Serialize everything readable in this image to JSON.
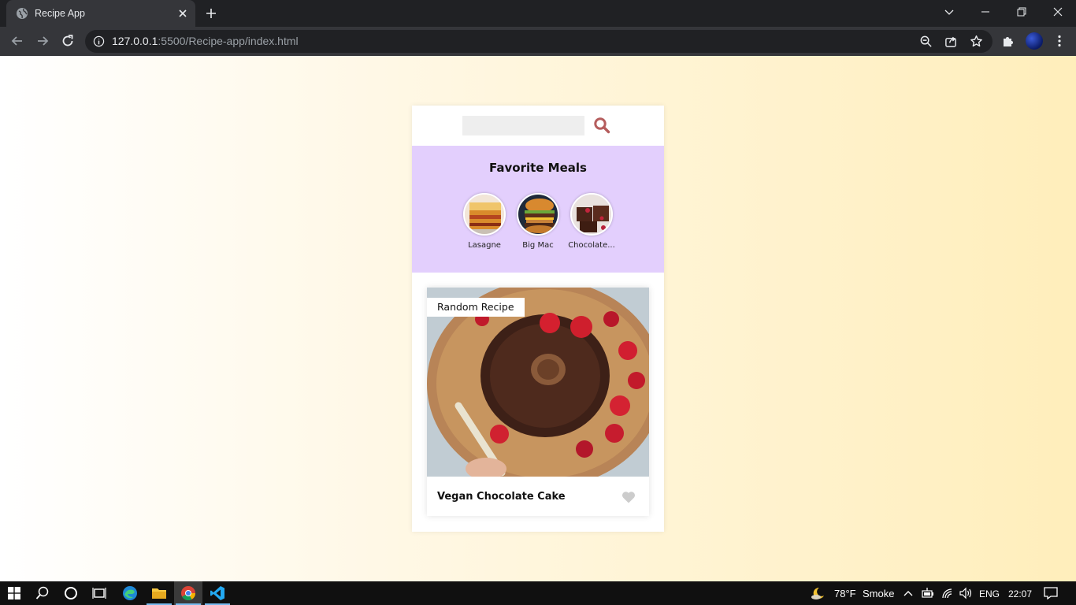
{
  "browser": {
    "tab_title": "Recipe App",
    "url_host": "127.0.0.1",
    "url_rest": ":5500/Recipe-app/index.html"
  },
  "app": {
    "search": {
      "placeholder": "",
      "value": ""
    },
    "favorites": {
      "heading": "Favorite Meals",
      "items": [
        {
          "name": "Lasagne"
        },
        {
          "name": "Big Mac"
        },
        {
          "name": "Chocolate..."
        }
      ]
    },
    "meal": {
      "tag": "Random Recipe",
      "title": "Vegan Chocolate Cake",
      "favorited": false
    },
    "colors": {
      "accent": "#b55d5d",
      "fav_bg": "#e3cffd",
      "heart_idle": "#cccccc"
    }
  },
  "taskbar": {
    "weather_temp": "78°F",
    "weather_desc": "Smoke",
    "language": "ENG",
    "time": "22:07"
  }
}
